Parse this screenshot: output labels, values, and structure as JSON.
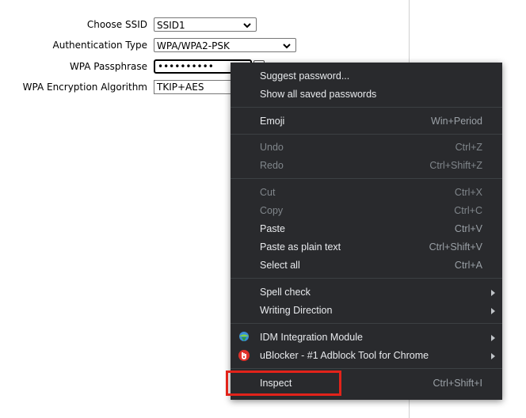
{
  "form": {
    "ssid": {
      "label": "Choose SSID",
      "value": "SSID1"
    },
    "auth": {
      "label": "Authentication Type",
      "value": "WPA/WPA2-PSK"
    },
    "pass": {
      "label": "WPA Passphrase",
      "value": "••••••••••"
    },
    "enc": {
      "label": "WPA Encryption Algorithm",
      "value": "TKIP+AES"
    }
  },
  "menu": {
    "items": [
      {
        "label": "Suggest password...",
        "shortcut": ""
      },
      {
        "label": "Show all saved passwords",
        "shortcut": ""
      },
      {
        "label": "Emoji",
        "shortcut": "Win+Period"
      },
      {
        "label": "Undo",
        "shortcut": "Ctrl+Z"
      },
      {
        "label": "Redo",
        "shortcut": "Ctrl+Shift+Z"
      },
      {
        "label": "Cut",
        "shortcut": "Ctrl+X"
      },
      {
        "label": "Copy",
        "shortcut": "Ctrl+C"
      },
      {
        "label": "Paste",
        "shortcut": "Ctrl+V"
      },
      {
        "label": "Paste as plain text",
        "shortcut": "Ctrl+Shift+V"
      },
      {
        "label": "Select all",
        "shortcut": "Ctrl+A"
      },
      {
        "label": "Spell check",
        "shortcut": ""
      },
      {
        "label": "Writing Direction",
        "shortcut": ""
      },
      {
        "label": "IDM Integration Module",
        "shortcut": "",
        "icon": "idm-icon"
      },
      {
        "label": "uBlocker - #1 Adblock Tool for Chrome",
        "shortcut": "",
        "icon": "ublocker-icon"
      },
      {
        "label": "Inspect",
        "shortcut": "Ctrl+Shift+I"
      }
    ]
  },
  "colors": {
    "menu_bg": "#292a2d",
    "highlight": "#e2231a"
  }
}
